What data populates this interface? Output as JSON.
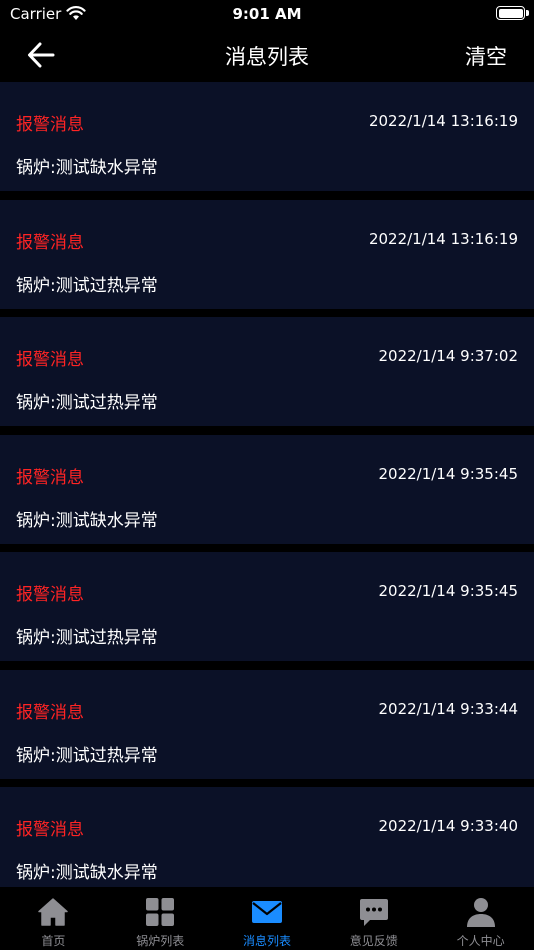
{
  "status_bar": {
    "carrier": "Carrier",
    "time": "9:01 AM"
  },
  "nav": {
    "title": "消息列表",
    "clear_label": "清空",
    "back_icon": "arrow-left-icon"
  },
  "messages": [
    {
      "type": "报警消息",
      "time": "2022/1/14 13:16:19",
      "content": "锅炉:测试缺水异常"
    },
    {
      "type": "报警消息",
      "time": "2022/1/14 13:16:19",
      "content": "锅炉:测试过热异常"
    },
    {
      "type": "报警消息",
      "time": "2022/1/14 9:37:02",
      "content": "锅炉:测试过热异常"
    },
    {
      "type": "报警消息",
      "time": "2022/1/14 9:35:45",
      "content": "锅炉:测试缺水异常"
    },
    {
      "type": "报警消息",
      "time": "2022/1/14 9:35:45",
      "content": "锅炉:测试过热异常"
    },
    {
      "type": "报警消息",
      "time": "2022/1/14 9:33:44",
      "content": "锅炉:测试过热异常"
    },
    {
      "type": "报警消息",
      "time": "2022/1/14 9:33:40",
      "content": "锅炉:测试缺水异常"
    }
  ],
  "tabs": [
    {
      "label": "首页",
      "icon": "home-icon",
      "active": false
    },
    {
      "label": "锅炉列表",
      "icon": "grid-icon",
      "active": false
    },
    {
      "label": "消息列表",
      "icon": "mail-icon",
      "active": true
    },
    {
      "label": "意见反馈",
      "icon": "chat-bubble-icon",
      "active": false
    },
    {
      "label": "个人中心",
      "icon": "person-icon",
      "active": false
    }
  ],
  "colors": {
    "background": "#000000",
    "card": "#0b1127",
    "alarm_red": "#ff2424",
    "tab_active": "#1a8cff",
    "tab_inactive": "#8e8e93"
  }
}
